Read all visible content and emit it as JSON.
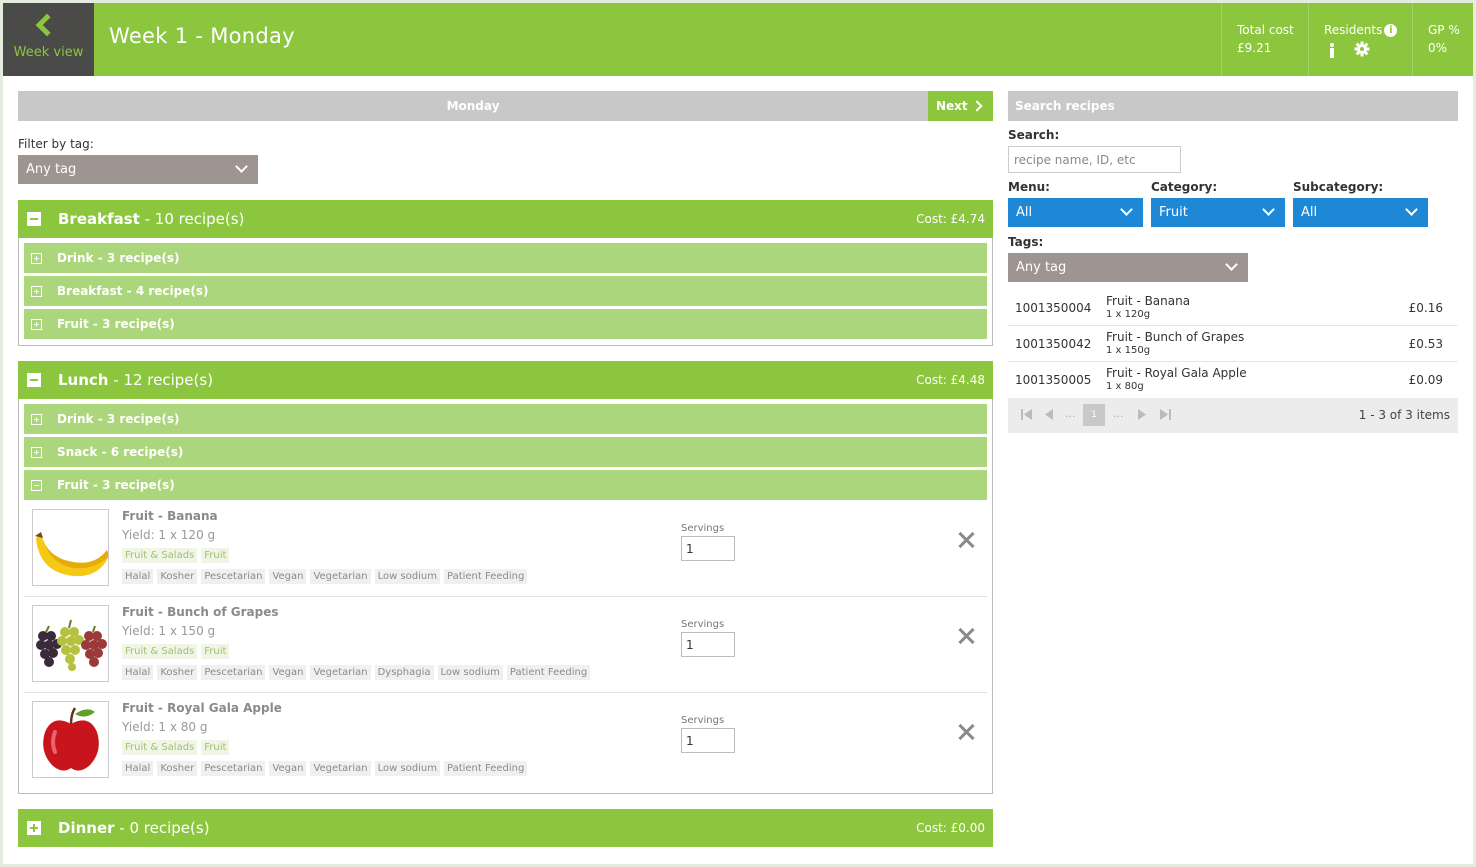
{
  "header": {
    "back_label": "Week view",
    "title": "Week 1 - Monday",
    "total_cost_label": "Total cost",
    "total_cost_value": "£9.21",
    "residents_label": "Residents",
    "gp_label": "GP %",
    "gp_value": "0%"
  },
  "nav": {
    "day": "Monday",
    "next_label": "Next"
  },
  "filter": {
    "label": "Filter by tag:",
    "selected": "Any tag"
  },
  "meals": {
    "breakfast": {
      "name": "Breakfast",
      "count": " - 10 recipe(s)",
      "cost": "Cost: £4.74",
      "subs": [
        "Drink - 3 recipe(s)",
        "Breakfast - 4 recipe(s)",
        "Fruit - 3 recipe(s)"
      ]
    },
    "lunch": {
      "name": "Lunch",
      "count": " - 12 recipe(s)",
      "cost": "Cost: £4.48",
      "subs": [
        "Drink - 3 recipe(s)",
        "Snack - 6 recipe(s)",
        "Fruit - 3 recipe(s)"
      ],
      "recipes": [
        {
          "name": "Fruit - Banana",
          "yield": "Yield: 1 x 120 g",
          "cat_tags": [
            "Fruit & Salads",
            "Fruit"
          ],
          "diet_tags": [
            "Halal",
            "Kosher",
            "Pescetarian",
            "Vegan",
            "Vegetarian",
            "Low sodium",
            "Patient Feeding"
          ],
          "servings_label": "Servings",
          "servings": "1"
        },
        {
          "name": "Fruit - Bunch of Grapes",
          "yield": "Yield: 1 x 150 g",
          "cat_tags": [
            "Fruit & Salads",
            "Fruit"
          ],
          "diet_tags": [
            "Halal",
            "Kosher",
            "Pescetarian",
            "Vegan",
            "Vegetarian",
            "Dysphagia",
            "Low sodium",
            "Patient Feeding"
          ],
          "servings_label": "Servings",
          "servings": "1"
        },
        {
          "name": "Fruit - Royal Gala Apple",
          "yield": "Yield: 1 x 80 g",
          "cat_tags": [
            "Fruit & Salads",
            "Fruit"
          ],
          "diet_tags": [
            "Halal",
            "Kosher",
            "Pescetarian",
            "Vegan",
            "Vegetarian",
            "Low sodium",
            "Patient Feeding"
          ],
          "servings_label": "Servings",
          "servings": "1"
        }
      ]
    },
    "dinner": {
      "name": "Dinner",
      "count": " - 0 recipe(s)",
      "cost": "Cost: £0.00"
    }
  },
  "search": {
    "header": "Search recipes",
    "search_label": "Search:",
    "search_placeholder": "recipe name, ID, etc",
    "menu_label": "Menu:",
    "menu_value": "All",
    "category_label": "Category:",
    "category_value": "Fruit",
    "subcategory_label": "Subcategory:",
    "subcategory_value": "All",
    "tags_label": "Tags:",
    "tags_value": "Any tag",
    "results": [
      {
        "id": "1001350004",
        "name": "Fruit - Banana",
        "size": "1 x 120g",
        "price": "£0.16"
      },
      {
        "id": "1001350042",
        "name": "Fruit - Bunch of Grapes",
        "size": "1 x 150g",
        "price": "£0.53"
      },
      {
        "id": "1001350005",
        "name": "Fruit - Royal Gala Apple",
        "size": "1 x 80g",
        "price": "£0.09"
      }
    ],
    "pager": {
      "ellipsis_left": "...",
      "current_page": "1",
      "ellipsis_right": "...",
      "items": "1 - 3 of 3 items"
    }
  },
  "colors": {
    "brand_green": "#8cc63f",
    "sub_green": "#acd67c",
    "dropdown_blue": "#1e88d6",
    "dropdown_grey": "#9e9490",
    "header_dark": "#4a4a48"
  },
  "icons": [
    "chevron-left-icon",
    "info-icon",
    "person-icon",
    "gear-icon",
    "chevron-right-icon",
    "chevron-down-icon",
    "minus-square-icon",
    "plus-square-icon",
    "close-icon",
    "first-page-icon",
    "prev-page-icon",
    "next-page-icon",
    "last-page-icon"
  ]
}
